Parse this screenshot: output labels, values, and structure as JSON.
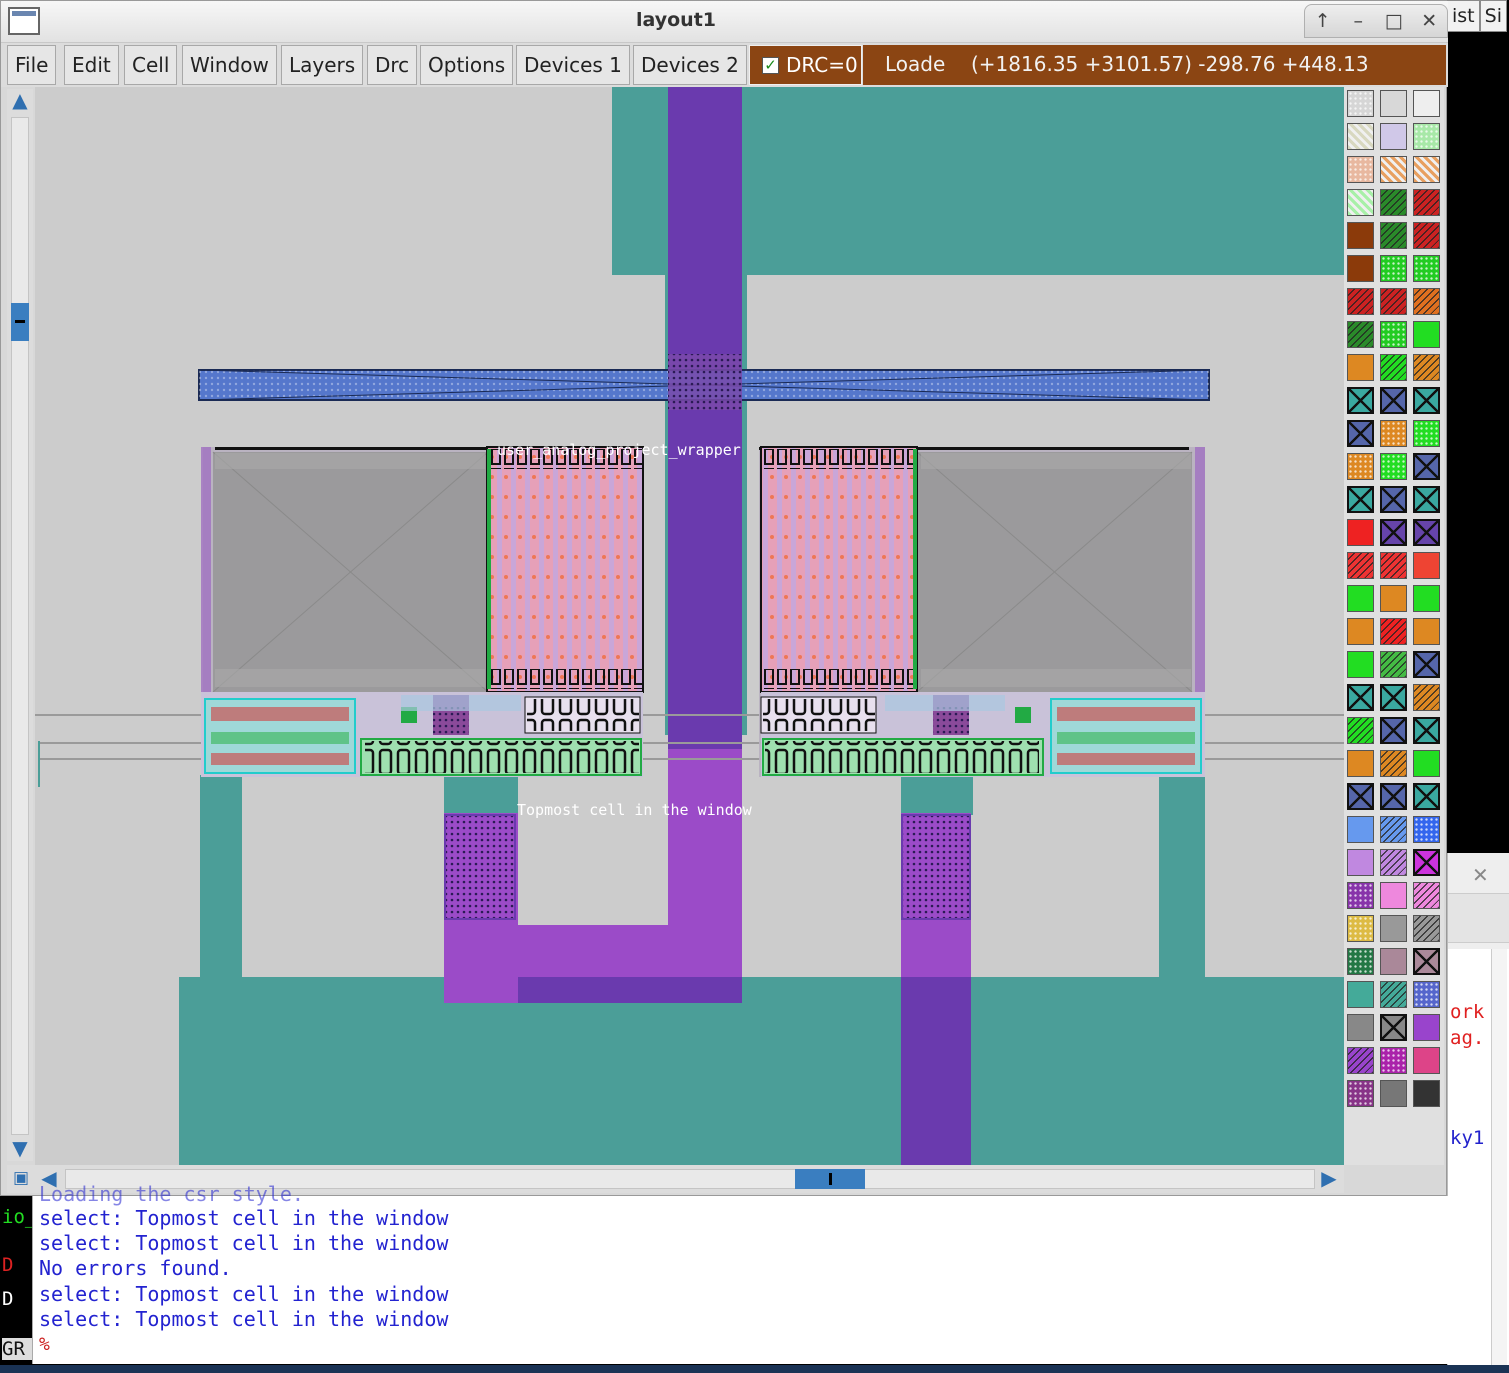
{
  "window": {
    "title": "layout1",
    "wm_buttons": [
      "↑",
      "–",
      "□",
      "✕"
    ]
  },
  "menu": {
    "items": [
      "File",
      "Edit",
      "Cell",
      "Window",
      "Layers",
      "Drc",
      "Options",
      "Devices 1",
      "Devices 2"
    ]
  },
  "drc": {
    "label": "DRC=0",
    "checked": true
  },
  "status": {
    "load_text": "Loade",
    "coords": "(+1816.35 +3101.57) -298.76 +448.13 microns"
  },
  "canvas": {
    "labels": {
      "wrapper": "user_analog_project_wrapper",
      "topmost": "Topmost cell in the window"
    },
    "colors": {
      "background": "#cccccc",
      "metal_teal": "#4b9e98",
      "via_purple": "#6a3aae",
      "via_magenta": "#9b4bc8",
      "poly_blue": "#5577cc"
    }
  },
  "background_windows": {
    "tab_labels": [
      "ist",
      "Si"
    ],
    "panel_text": [
      "ork",
      "ag.",
      "ky1"
    ],
    "left_text": [
      "io_",
      "D",
      "D",
      "GR"
    ]
  },
  "console": {
    "partial_line": "Loading the csr style.",
    "lines": [
      "select: Topmost cell in the window",
      "select: Topmost cell in the window",
      "No errors found.",
      "select: Topmost cell in the window",
      "select: Topmost cell in the window"
    ],
    "prompt": "%"
  },
  "palette": {
    "rows": [
      [
        "#d6d6d6:dots",
        "#d8d8d8:plain",
        "#eeeeee:plain"
      ],
      [
        "#d8d8c0:hatch",
        "#d0c8e8:plain",
        "#a8e8a8:dots"
      ],
      [
        "#e8b8a0:dots",
        "#e8a060:hatch",
        "#e8a060:hatch"
      ],
      [
        "#a8f0a8:hatch",
        "#2a8a2a:stripes",
        "#cc2222:stripes"
      ],
      [
        "#8b3a0a:plain",
        "#2a8a2a:stripes",
        "#cc2222:stripes"
      ],
      [
        "#8b3a0a:plain",
        "#22cc22:dots",
        "#22cc22:dots"
      ],
      [
        "#cc2222:stripes",
        "#cc2222:stripes",
        "#e07020:stripes"
      ],
      [
        "#2a8a2a:stripes",
        "#22cc22:dots",
        "#22dd22:plain"
      ],
      [
        "#dd8822:plain",
        "#22dd22:stripes",
        "#dd8822:stripes"
      ],
      [
        "#3aa8a0:cross",
        "#5566aa:cross",
        "#3aa8a0:cross"
      ],
      [
        "#5566aa:cross",
        "#dd8822:dots",
        "#22dd22:dots"
      ],
      [
        "#dd8822:dots",
        "#22dd22:dots",
        "#5566aa:cross"
      ],
      [
        "#3aa8a0:cross",
        "#5566aa:cross",
        "#3aa8a0:cross"
      ],
      [
        "#ee2222:plain",
        "#6644aa:cross",
        "#6644aa:cross"
      ],
      [
        "#ee3333:stripes",
        "#ee3333:stripes",
        "#ee4433:plain"
      ],
      [
        "#22dd22:plain",
        "#dd8822:plain",
        "#22dd22:plain"
      ],
      [
        "#dd8822:plain",
        "#ee2222:stripes",
        "#dd8822:plain"
      ],
      [
        "#22dd22:plain",
        "#44bb44:stripes",
        "#5566aa:cross"
      ],
      [
        "#3aa8a0:cross",
        "#3aa8a0:cross",
        "#dd8822:stripes"
      ],
      [
        "#22dd22:stripes",
        "#5566aa:cross",
        "#3aa8a0:cross"
      ],
      [
        "#dd8822:plain",
        "#dd8822:stripes",
        "#22dd22:plain"
      ],
      [
        "#5566aa:cross",
        "#5566aa:cross",
        "#3aa8a0:cross"
      ],
      [
        "#6699ee:plain",
        "#6699ee:stripes",
        "#3366ee:dots"
      ],
      [
        "#c088e0:plain",
        "#c088e0:stripes",
        "#cc33dd:cross"
      ],
      [
        "#8833aa:dots",
        "#ee88dd:plain",
        "#ee88dd:stripes"
      ],
      [
        "#ddbb44:dots",
        "#999999:plain",
        "#999999:stripes"
      ],
      [
        "#227744:dots",
        "#aa8899:plain",
        "#aa8899:cross"
      ],
      [
        "#44aa99:plain",
        "#44aa99:stripes",
        "#5566cc:dots"
      ],
      [
        "#888888:plain",
        "#888888:cross",
        "#9944cc:plain"
      ],
      [
        "#9944cc:stripes",
        "#aa22aa:dots",
        "#dd4488:plain"
      ],
      [
        "#883388:dots",
        "#777777:plain",
        "#333333:plain"
      ]
    ]
  }
}
